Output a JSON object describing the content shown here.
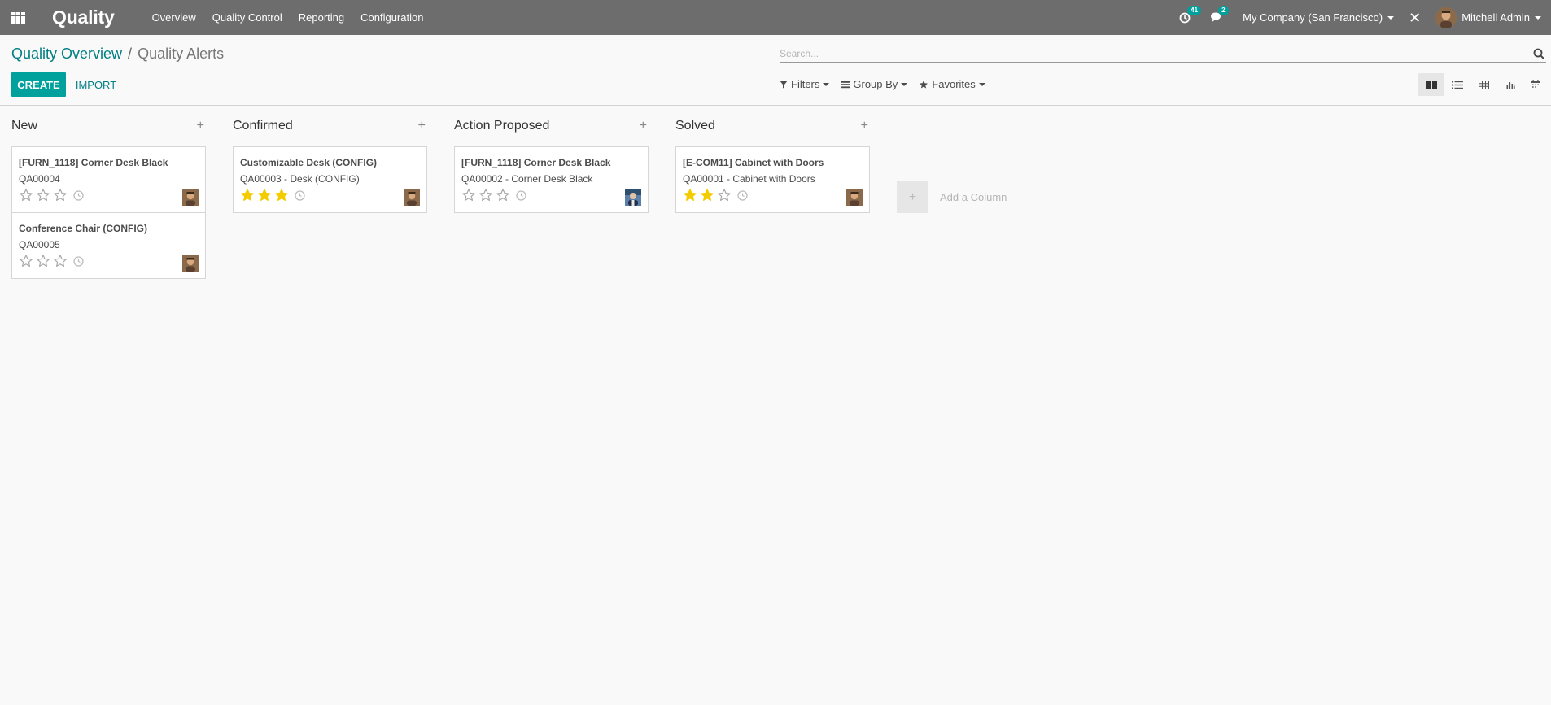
{
  "navbar": {
    "app_title": "Quality",
    "menu": [
      "Overview",
      "Quality Control",
      "Reporting",
      "Configuration"
    ],
    "activity_badge": "41",
    "messages_badge": "2",
    "company": "My Company (San Francisco)",
    "user": "Mitchell Admin"
  },
  "breadcrumb": {
    "parent": "Quality Overview",
    "separator": "/",
    "current": "Quality Alerts"
  },
  "search": {
    "placeholder": "Search..."
  },
  "buttons": {
    "create": "CREATE",
    "import": "IMPORT"
  },
  "search_options": {
    "filters": "Filters",
    "group_by": "Group By",
    "favorites": "Favorites"
  },
  "views": [
    "kanban",
    "list",
    "pivot",
    "graph",
    "calendar"
  ],
  "kanban": {
    "add_column_label": "Add a Column",
    "columns": [
      {
        "title": "New",
        "cards": [
          {
            "title": "[FURN_1118] Corner Desk Black",
            "subtitle": "QA00004",
            "stars": 0,
            "avatar": "mitchell"
          },
          {
            "title": "Conference Chair (CONFIG)",
            "subtitle": "QA00005",
            "stars": 0,
            "avatar": "mitchell"
          }
        ]
      },
      {
        "title": "Confirmed",
        "cards": [
          {
            "title": "Customizable Desk (CONFIG)",
            "subtitle": "QA00003 - Desk (CONFIG)",
            "stars": 3,
            "avatar": "mitchell"
          }
        ]
      },
      {
        "title": "Action Proposed",
        "cards": [
          {
            "title": "[FURN_1118] Corner Desk Black",
            "subtitle": "QA00002 - Corner Desk Black",
            "stars": 0,
            "avatar": "demo"
          }
        ]
      },
      {
        "title": "Solved",
        "cards": [
          {
            "title": "[E-COM11] Cabinet with Doors",
            "subtitle": "QA00001 - Cabinet with Doors",
            "stars": 2,
            "avatar": "mitchell"
          }
        ]
      }
    ]
  },
  "colors": {
    "navbar": "#6d6d6d",
    "primary": "#00a09d",
    "link": "#017e84",
    "star_filled": "#f3cc00",
    "star_empty": "#a8a8a8"
  }
}
